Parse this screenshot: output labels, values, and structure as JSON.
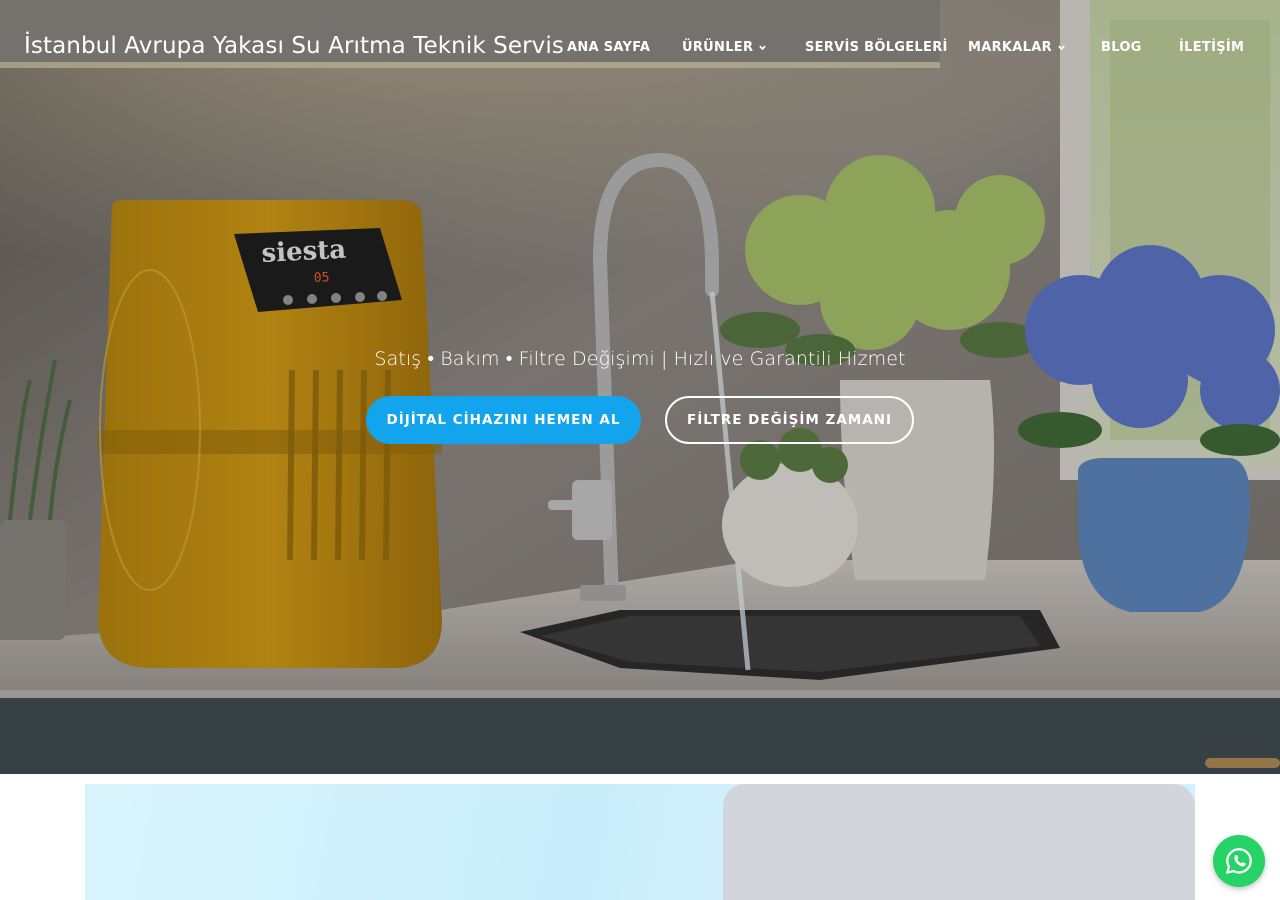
{
  "header": {
    "site_title": "İstanbul Avrupa Yakası Su Arıtma Teknik Servis"
  },
  "nav": {
    "items": [
      {
        "label": "ANA SAYFA",
        "has_dropdown": false
      },
      {
        "label": "ÜRÜNLER",
        "has_dropdown": true
      },
      {
        "label": "SERVİS BÖLGELERİ",
        "has_dropdown": false
      },
      {
        "label": "MARKALAR",
        "has_dropdown": true
      },
      {
        "label": "BLOG",
        "has_dropdown": false
      },
      {
        "label": "İLETİŞİM",
        "has_dropdown": false
      }
    ]
  },
  "hero": {
    "tagline": "Satış • Bakım • Filtre Değişimi | Hızlı ve Garantili Hizmet",
    "primary_button": "DİJİTAL CİHAZINI HEMEN AL",
    "secondary_button": "FİLTRE DEĞİŞİM ZAMANI",
    "device_brand": "siesta",
    "device_display": "05"
  },
  "floating": {
    "whatsapp_icon": "whatsapp-icon"
  },
  "colors": {
    "primary_button": "#12a4ec",
    "whatsapp": "#25d366",
    "promo_strip": "#d2f1fc",
    "promo_card": "#d2d5db"
  }
}
